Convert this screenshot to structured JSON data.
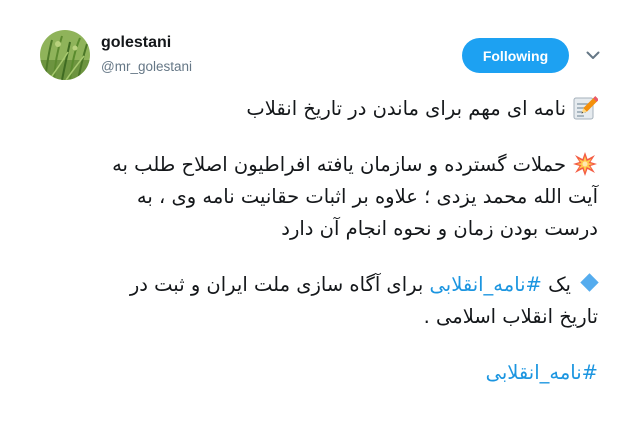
{
  "author": {
    "display_name": "golestani",
    "handle": "@mr_golestani"
  },
  "follow_button": {
    "label": "Following"
  },
  "icons": {
    "menu": "chevron-down-icon",
    "memo": "memo-icon",
    "collision": "collision-icon",
    "diamond": "small-blue-diamond-icon"
  },
  "colors": {
    "accent": "#1da1f2",
    "hashtag": "#1b95e0",
    "handle": "#657786"
  },
  "tweet": {
    "line1": "نامه ای مهم برای ماندن در تاریخ انقلاب",
    "para2_line1": "حملات گسترده و سازمان یافته افراطیون اصلاح طلب به",
    "para2_line2": "آیت الله محمد یزدی ؛ علاوه بر اثبات حقانیت نامه وی ، به",
    "para2_line3": "درست بودن زمان و نحوه انجام آن دارد",
    "para3_prefix": "یک",
    "para3_hashtag": "#نامه_انقلابی",
    "para3_rest": "برای آگاه سازی ملت ایران و ثبت در",
    "para3_line2": "تاریخ انقلاب اسلامی .",
    "final_hashtag": "#نامه_انقلابی"
  }
}
